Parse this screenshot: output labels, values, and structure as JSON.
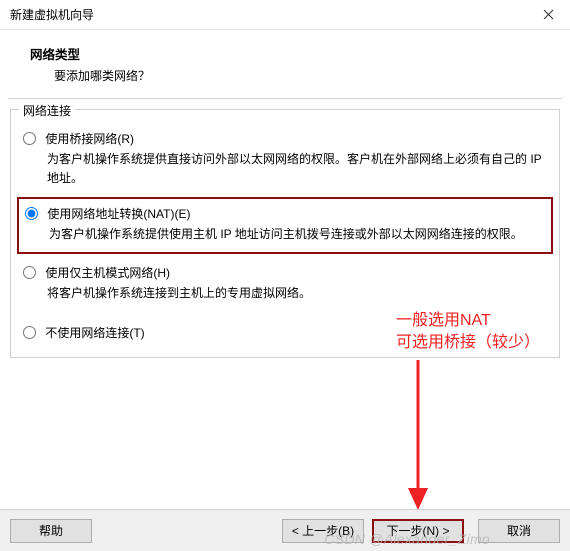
{
  "titlebar": {
    "title": "新建虚拟机向导"
  },
  "header": {
    "heading": "网络类型",
    "subheading": "要添加哪类网络？"
  },
  "fieldset_legend": "网络连接",
  "options": {
    "bridged": {
      "label": "使用桥接网络(R)",
      "desc": "为客户机操作系统提供直接访问外部以太网网络的权限。客户机在外部网络上必须有自己的 IP 地址。"
    },
    "nat": {
      "label": "使用网络地址转换(NAT)(E)",
      "desc": "为客户机操作系统提供使用主机 IP 地址访问主机拨号连接或外部以太网网络连接的权限。"
    },
    "hostonly": {
      "label": "使用仅主机模式网络(H)",
      "desc": "将客户机操作系统连接到主机上的专用虚拟网络。"
    },
    "none": {
      "label": "不使用网络连接(T)"
    }
  },
  "footer": {
    "help": "帮助",
    "back": "< 上一步(B)",
    "next": "下一步(N) >",
    "cancel": "取消"
  },
  "annotation": {
    "line1": "一般选用NAT",
    "line2": "可选用桥接（较少）"
  },
  "watermark": "CSDN @Alexander_Zimo"
}
